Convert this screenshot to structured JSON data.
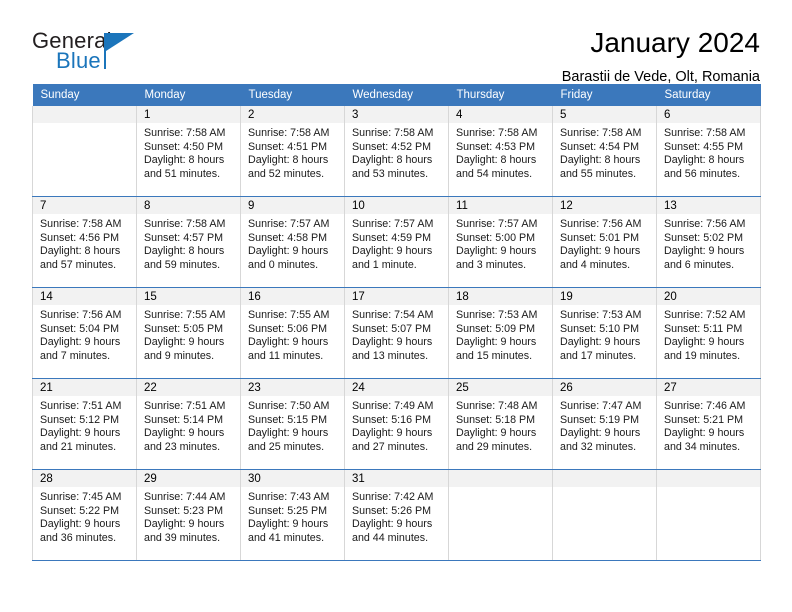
{
  "brand": {
    "name_top": "General",
    "name_bottom": "Blue",
    "accent_color": "#1b75bb"
  },
  "header": {
    "title": "January 2024",
    "subtitle": "Barastii de Vede, Olt, Romania"
  },
  "calendar": {
    "header_color": "#3b78bc",
    "weekday_headers": [
      "Sunday",
      "Monday",
      "Tuesday",
      "Wednesday",
      "Thursday",
      "Friday",
      "Saturday"
    ],
    "weeks": [
      [
        {
          "day": "",
          "lines": []
        },
        {
          "day": "1",
          "lines": [
            "Sunrise: 7:58 AM",
            "Sunset: 4:50 PM",
            "Daylight: 8 hours",
            "and 51 minutes."
          ]
        },
        {
          "day": "2",
          "lines": [
            "Sunrise: 7:58 AM",
            "Sunset: 4:51 PM",
            "Daylight: 8 hours",
            "and 52 minutes."
          ]
        },
        {
          "day": "3",
          "lines": [
            "Sunrise: 7:58 AM",
            "Sunset: 4:52 PM",
            "Daylight: 8 hours",
            "and 53 minutes."
          ]
        },
        {
          "day": "4",
          "lines": [
            "Sunrise: 7:58 AM",
            "Sunset: 4:53 PM",
            "Daylight: 8 hours",
            "and 54 minutes."
          ]
        },
        {
          "day": "5",
          "lines": [
            "Sunrise: 7:58 AM",
            "Sunset: 4:54 PM",
            "Daylight: 8 hours",
            "and 55 minutes."
          ]
        },
        {
          "day": "6",
          "lines": [
            "Sunrise: 7:58 AM",
            "Sunset: 4:55 PM",
            "Daylight: 8 hours",
            "and 56 minutes."
          ]
        }
      ],
      [
        {
          "day": "7",
          "lines": [
            "Sunrise: 7:58 AM",
            "Sunset: 4:56 PM",
            "Daylight: 8 hours",
            "and 57 minutes."
          ]
        },
        {
          "day": "8",
          "lines": [
            "Sunrise: 7:58 AM",
            "Sunset: 4:57 PM",
            "Daylight: 8 hours",
            "and 59 minutes."
          ]
        },
        {
          "day": "9",
          "lines": [
            "Sunrise: 7:57 AM",
            "Sunset: 4:58 PM",
            "Daylight: 9 hours",
            "and 0 minutes."
          ]
        },
        {
          "day": "10",
          "lines": [
            "Sunrise: 7:57 AM",
            "Sunset: 4:59 PM",
            "Daylight: 9 hours",
            "and 1 minute."
          ]
        },
        {
          "day": "11",
          "lines": [
            "Sunrise: 7:57 AM",
            "Sunset: 5:00 PM",
            "Daylight: 9 hours",
            "and 3 minutes."
          ]
        },
        {
          "day": "12",
          "lines": [
            "Sunrise: 7:56 AM",
            "Sunset: 5:01 PM",
            "Daylight: 9 hours",
            "and 4 minutes."
          ]
        },
        {
          "day": "13",
          "lines": [
            "Sunrise: 7:56 AM",
            "Sunset: 5:02 PM",
            "Daylight: 9 hours",
            "and 6 minutes."
          ]
        }
      ],
      [
        {
          "day": "14",
          "lines": [
            "Sunrise: 7:56 AM",
            "Sunset: 5:04 PM",
            "Daylight: 9 hours",
            "and 7 minutes."
          ]
        },
        {
          "day": "15",
          "lines": [
            "Sunrise: 7:55 AM",
            "Sunset: 5:05 PM",
            "Daylight: 9 hours",
            "and 9 minutes."
          ]
        },
        {
          "day": "16",
          "lines": [
            "Sunrise: 7:55 AM",
            "Sunset: 5:06 PM",
            "Daylight: 9 hours",
            "and 11 minutes."
          ]
        },
        {
          "day": "17",
          "lines": [
            "Sunrise: 7:54 AM",
            "Sunset: 5:07 PM",
            "Daylight: 9 hours",
            "and 13 minutes."
          ]
        },
        {
          "day": "18",
          "lines": [
            "Sunrise: 7:53 AM",
            "Sunset: 5:09 PM",
            "Daylight: 9 hours",
            "and 15 minutes."
          ]
        },
        {
          "day": "19",
          "lines": [
            "Sunrise: 7:53 AM",
            "Sunset: 5:10 PM",
            "Daylight: 9 hours",
            "and 17 minutes."
          ]
        },
        {
          "day": "20",
          "lines": [
            "Sunrise: 7:52 AM",
            "Sunset: 5:11 PM",
            "Daylight: 9 hours",
            "and 19 minutes."
          ]
        }
      ],
      [
        {
          "day": "21",
          "lines": [
            "Sunrise: 7:51 AM",
            "Sunset: 5:12 PM",
            "Daylight: 9 hours",
            "and 21 minutes."
          ]
        },
        {
          "day": "22",
          "lines": [
            "Sunrise: 7:51 AM",
            "Sunset: 5:14 PM",
            "Daylight: 9 hours",
            "and 23 minutes."
          ]
        },
        {
          "day": "23",
          "lines": [
            "Sunrise: 7:50 AM",
            "Sunset: 5:15 PM",
            "Daylight: 9 hours",
            "and 25 minutes."
          ]
        },
        {
          "day": "24",
          "lines": [
            "Sunrise: 7:49 AM",
            "Sunset: 5:16 PM",
            "Daylight: 9 hours",
            "and 27 minutes."
          ]
        },
        {
          "day": "25",
          "lines": [
            "Sunrise: 7:48 AM",
            "Sunset: 5:18 PM",
            "Daylight: 9 hours",
            "and 29 minutes."
          ]
        },
        {
          "day": "26",
          "lines": [
            "Sunrise: 7:47 AM",
            "Sunset: 5:19 PM",
            "Daylight: 9 hours",
            "and 32 minutes."
          ]
        },
        {
          "day": "27",
          "lines": [
            "Sunrise: 7:46 AM",
            "Sunset: 5:21 PM",
            "Daylight: 9 hours",
            "and 34 minutes."
          ]
        }
      ],
      [
        {
          "day": "28",
          "lines": [
            "Sunrise: 7:45 AM",
            "Sunset: 5:22 PM",
            "Daylight: 9 hours",
            "and 36 minutes."
          ]
        },
        {
          "day": "29",
          "lines": [
            "Sunrise: 7:44 AM",
            "Sunset: 5:23 PM",
            "Daylight: 9 hours",
            "and 39 minutes."
          ]
        },
        {
          "day": "30",
          "lines": [
            "Sunrise: 7:43 AM",
            "Sunset: 5:25 PM",
            "Daylight: 9 hours",
            "and 41 minutes."
          ]
        },
        {
          "day": "31",
          "lines": [
            "Sunrise: 7:42 AM",
            "Sunset: 5:26 PM",
            "Daylight: 9 hours",
            "and 44 minutes."
          ]
        },
        {
          "day": "",
          "lines": []
        },
        {
          "day": "",
          "lines": []
        },
        {
          "day": "",
          "lines": []
        }
      ]
    ]
  }
}
